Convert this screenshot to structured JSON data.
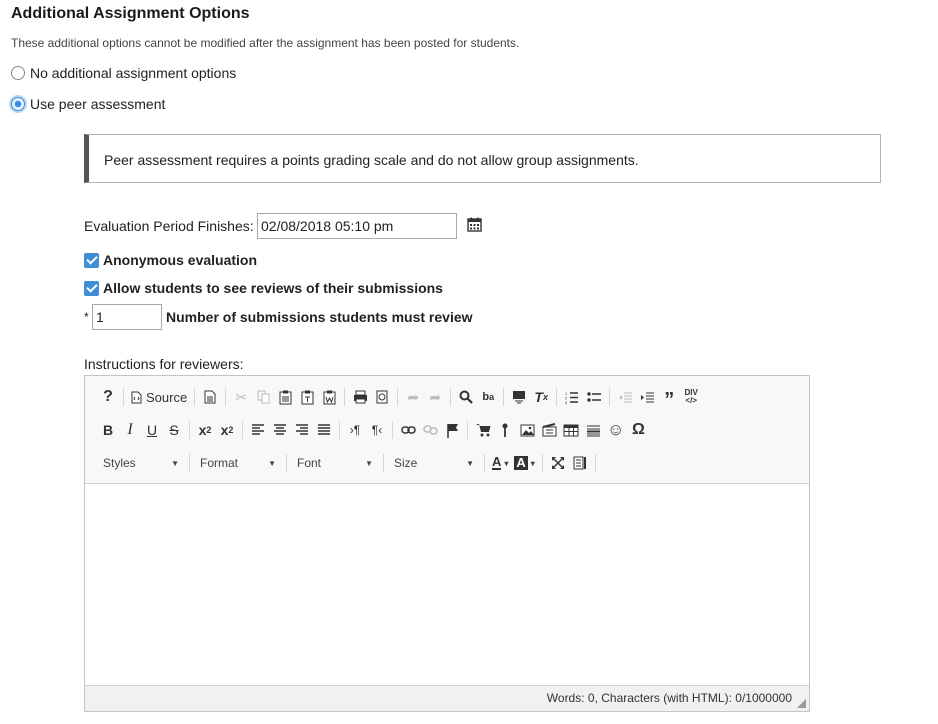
{
  "section": {
    "title": "Additional Assignment Options",
    "subtitle": "These additional options cannot be modified after the assignment has been posted for students."
  },
  "options": {
    "none_label": "No additional assignment options",
    "peer_label": "Use peer assessment",
    "selected": "peer"
  },
  "notice": {
    "text": "Peer assessment requires a points grading scale and do not allow group assignments."
  },
  "evaluation": {
    "label": "Evaluation Period Finishes:",
    "value": "02/08/2018 05:10 pm",
    "calendar_icon": "calendar-icon"
  },
  "checkboxes": {
    "anonymous_label": "Anonymous evaluation",
    "anonymous_checked": true,
    "allow_reviews_label": "Allow students to see reviews of their submissions",
    "allow_reviews_checked": true
  },
  "submissions": {
    "required_marker": "*",
    "value": "1",
    "label": "Number of submissions students must review"
  },
  "editor": {
    "label": "Instructions for reviewers:",
    "source_label": "Source",
    "styles_label": "Styles",
    "format_label": "Format",
    "font_label": "Font",
    "size_label": "Size",
    "status": "Words: 0, Characters (with HTML): 0/1000000",
    "colors": {
      "accent": "#3f8fd6",
      "toolbar_bg": "#f8f8f8",
      "footer_bg": "#f1f1f1"
    }
  }
}
